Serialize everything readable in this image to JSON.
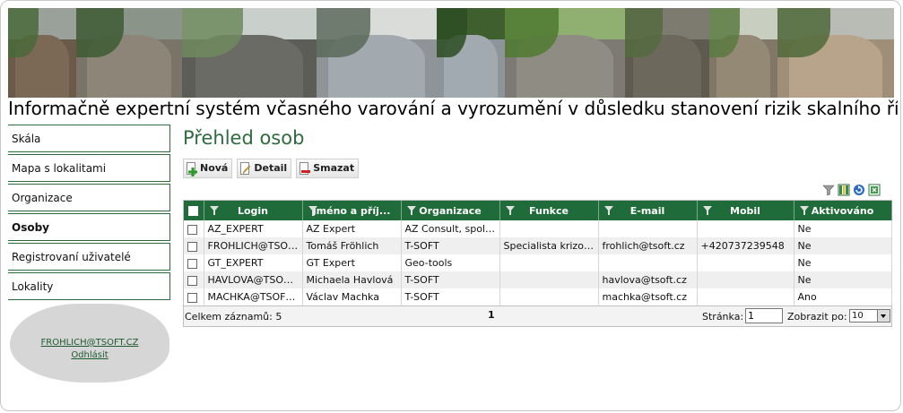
{
  "header": {
    "title": "Informačně expertní systém včasného varování a vyrozumění v důsledku stanovení rizik skalního řícení"
  },
  "banner_photos": [
    {
      "name": "photo-rock-cliff",
      "sky": "#9aa09a",
      "rock": "#6b5a4a",
      "leaf": "#4a6a3a",
      "w": 76
    },
    {
      "name": "photo-rockslide-forest",
      "sky": "#8a9488",
      "rock": "#7a7468",
      "leaf": "#3e5a34",
      "w": 118
    },
    {
      "name": "photo-road-boulders",
      "sky": "#c9cfca",
      "rock": "#5d5d58",
      "leaf": "#6e8a5e",
      "w": 150
    },
    {
      "name": "photo-police-roadblock",
      "sky": "#d9dcd9",
      "rock": "#8e9498",
      "leaf": "#5a6a5a",
      "w": 134
    },
    {
      "name": "photo-sensor-device",
      "sky": "#3f5f2f",
      "rock": "#8d949a",
      "leaf": "#2d4d22",
      "w": 76
    },
    {
      "name": "photo-green-rock",
      "sky": "#8fb070",
      "rock": "#7c7a72",
      "leaf": "#4f7a30",
      "w": 134
    },
    {
      "name": "photo-sandstone-wall",
      "sky": "#7d7b70",
      "rock": "#5e5a50",
      "leaf": "#556b40",
      "w": 94
    },
    {
      "name": "photo-rock-tower",
      "sky": "#c8cfc0",
      "rock": "#807766",
      "leaf": "#5a7a3f",
      "w": 76
    },
    {
      "name": "photo-boulder-road",
      "sky": "#b9bcb4",
      "rock": "#a08f78",
      "leaf": "#4f6a3a",
      "w": 130
    }
  ],
  "sidebar": {
    "items": [
      {
        "label": "Skála",
        "active": false
      },
      {
        "label": "Mapa s lokalitami",
        "active": false
      },
      {
        "label": "Organizace",
        "active": false
      },
      {
        "label": "Osoby",
        "active": true
      },
      {
        "label": "Registrovaní uživatelé",
        "active": false
      },
      {
        "label": "Lokality",
        "active": false
      }
    ],
    "user": "FROHLICH@TSOFT.CZ",
    "logout": "Odhlásit"
  },
  "main": {
    "title": "Přehled osob",
    "toolbar": {
      "new_label": "Nová",
      "detail_label": "Detail",
      "delete_label": "Smazat"
    }
  },
  "grid": {
    "columns": [
      "Login",
      "Jméno a příj...",
      "Organizace",
      "Funkce",
      "E-mail",
      "Mobil",
      "Aktivováno"
    ],
    "rows": [
      [
        "AZ_EXPERT",
        "AZ Expert",
        "AZ Consult, spol....",
        "",
        "",
        "",
        "Ne"
      ],
      [
        "FROHLICH@TSOFT...",
        "Tomáš Fröhlich",
        "T-SOFT",
        "Specialista krizov...",
        "frohlich@tsoft.cz",
        "+420737239548",
        "Ne"
      ],
      [
        "GT_EXPERT",
        "GT Expert",
        "Geo-tools",
        "",
        "",
        "",
        "Ne"
      ],
      [
        "HAVLOVA@TSOFT....",
        "Michaela Havlová",
        "T-SOFT",
        "",
        "havlova@tsoft.cz",
        "",
        "Ne"
      ],
      [
        "MACHKA@TSOFT....",
        "Václav Machka",
        "T-SOFT",
        "",
        "machka@tsoft.cz",
        "",
        "Ano"
      ]
    ],
    "footer": {
      "total": "Celkem záznamů: 5",
      "page_number": "1",
      "page_label": "Stránka:",
      "page_input": "1",
      "show_label": "Zobrazit po:",
      "page_size": "10"
    }
  },
  "colors": {
    "accent": "#1f6b3a",
    "title_green": "#2e6b3e"
  }
}
